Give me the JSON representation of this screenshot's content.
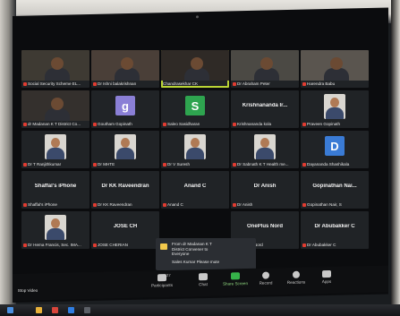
{
  "app": {
    "colors": {
      "background": "#0b0c0e",
      "tile": "#202326",
      "active_speaker": "#b9d435",
      "muted_mic": "#e03c31",
      "share_screen": "#36b24a"
    }
  },
  "tiles": [
    {
      "name": "Social Security Scheme EL...",
      "kind": "video",
      "muted": true
    },
    {
      "name": "Dr Ishni balakrishnan",
      "kind": "video",
      "muted": true
    },
    {
      "name": "Chandrasekhar CK",
      "kind": "video",
      "muted": false,
      "speaking": true
    },
    {
      "name": "Dr Abraham Peter",
      "kind": "video",
      "muted": true
    },
    {
      "name": "Harendra Babu",
      "kind": "video",
      "muted": true
    },
    {
      "name": "dr Madanan K T District Co...",
      "kind": "video",
      "muted": true
    },
    {
      "name": "Goutham Gopinath",
      "kind": "avatar",
      "avatar_letter": "g",
      "avatar_color": "#8a7fd6",
      "muted": true
    },
    {
      "name": "Saleo Sasidharan",
      "kind": "avatar",
      "avatar_letter": "S",
      "avatar_color": "#2ea44f",
      "muted": true
    },
    {
      "name": "Krishnananda kola",
      "kind": "text",
      "center_label": "Krishnananda Ir...",
      "muted": true
    },
    {
      "name": "Praveen Gopinath",
      "kind": "photo",
      "muted": true
    },
    {
      "name": "Dr T Ranjithkumar",
      "kind": "photo",
      "muted": true
    },
    {
      "name": "Dr MHTE",
      "kind": "photo",
      "muted": true
    },
    {
      "name": "Dr V Suresh",
      "kind": "photo",
      "muted": true
    },
    {
      "name": "Dr Sabnath K T Health me...",
      "kind": "photo",
      "muted": true
    },
    {
      "name": "Dayananda Shashikala",
      "kind": "avatar",
      "avatar_letter": "D",
      "avatar_color": "#3a7bd5",
      "muted": true
    },
    {
      "name": "Shaffal's iPhone",
      "kind": "text",
      "center_label": "Shaffal's iPhone",
      "muted": true
    },
    {
      "name": "Dr KK Raveendran",
      "kind": "text",
      "center_label": "Dr KK Raveendran",
      "muted": true
    },
    {
      "name": "Anand C",
      "kind": "text",
      "center_label": "Anand C",
      "muted": true
    },
    {
      "name": "Dr Anish",
      "kind": "text",
      "center_label": "Dr Anish",
      "muted": true
    },
    {
      "name": "Gopinathan Nair, S",
      "kind": "text",
      "center_label": "Gopinathan Nai...",
      "muted": true
    },
    {
      "name": "Dr Hema Francis, Sec. IMA...",
      "kind": "photo",
      "muted": true
    },
    {
      "name": "JOSE CHERIAN",
      "kind": "text",
      "center_label": "JOSE CH",
      "muted": true
    },
    {
      "name": "",
      "kind": "empty",
      "muted": false
    },
    {
      "name": "OnePlus Nord",
      "kind": "text",
      "center_label": "OnePlus Nord",
      "muted": true
    },
    {
      "name": "Dr Abubakker C",
      "kind": "text",
      "center_label": "Dr Abubakker C",
      "muted": true
    }
  ],
  "chat_notice": {
    "line1": "From dr Madanan K T",
    "line2": "District Convener to",
    "line3": "Everyone",
    "line4": "Sales Kumar Please mute"
  },
  "toolbar": {
    "stop_video": "Stop Video",
    "participants": "Participants",
    "participants_count": "37",
    "chat": "Chat",
    "share_screen": "Share Screen",
    "record": "Record",
    "reactions": "Reactions",
    "apps": "Apps"
  }
}
